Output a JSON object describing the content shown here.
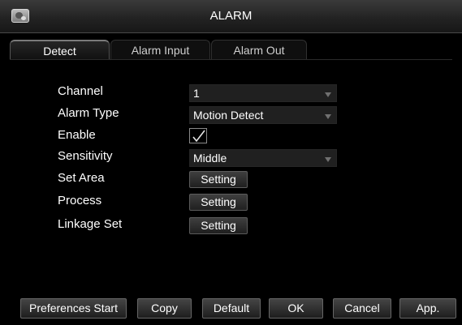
{
  "window": {
    "title": "ALARM",
    "icon": "camera-icon"
  },
  "tabs": [
    {
      "label": "Detect",
      "active": true
    },
    {
      "label": "Alarm Input",
      "active": false
    },
    {
      "label": "Alarm Out",
      "active": false
    }
  ],
  "form": {
    "channel": {
      "label": "Channel",
      "value": "1"
    },
    "alarm_type": {
      "label": "Alarm Type",
      "value": "Motion Detect"
    },
    "enable": {
      "label": "Enable",
      "checked": true
    },
    "sensitivity": {
      "label": "Sensitivity",
      "value": "Middle"
    },
    "set_area": {
      "label": "Set Area",
      "button": "Setting"
    },
    "process": {
      "label": "Process",
      "button": "Setting"
    },
    "linkage_set": {
      "label": "Linkage Set",
      "button": "Setting"
    }
  },
  "footer": {
    "preferences_start": "Preferences Start",
    "copy": "Copy",
    "default": "Default",
    "ok": "OK",
    "cancel": "Cancel",
    "apply": "App."
  }
}
